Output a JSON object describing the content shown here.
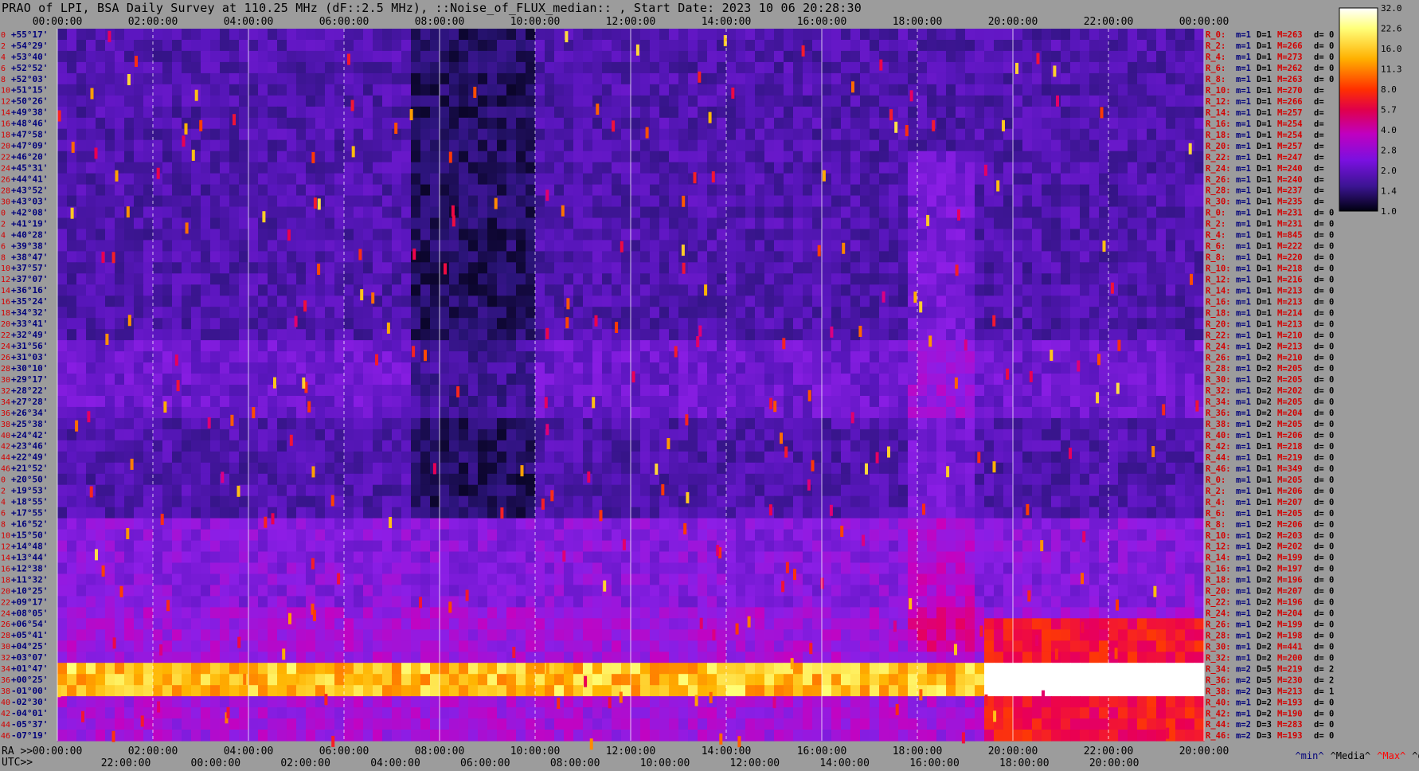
{
  "title": "PRAO of LPI, BSA Daily Survey at 110.25 MHz (dF::2.5 MHz), ::Noise_of_FLUX_median:: , Start Date: 2023 10 06 20:28:30",
  "footer": {
    "ra_label": "RA >>",
    "utc_label": "UTC>>"
  },
  "legend_bottom": {
    "min": "^min^",
    "media": "^Media^",
    "max": "^Max^",
    "devia": "^devia^"
  },
  "colors": {
    "background": "#9c9c9c",
    "label_red": "#d40000",
    "label_blue": "#00007a",
    "legend_max": "#ff0000"
  },
  "chart_data": {
    "type": "heatmap",
    "x_top_ticks": [
      "00:00:00",
      "02:00:00",
      "04:00:00",
      "06:00:00",
      "08:00:00",
      "10:00:00",
      "12:00:00",
      "14:00:00",
      "16:00:00",
      "18:00:00",
      "20:00:00",
      "22:00:00",
      "00:00:00"
    ],
    "x_bottom_ra_ticks": [
      "00:00:00",
      "02:00:00",
      "04:00:00",
      "06:00:00",
      "08:00:00",
      "10:00:00",
      "12:00:00",
      "14:00:00",
      "16:00:00",
      "18:00:00",
      "20:00:00",
      "22:00:00",
      "20:00:00"
    ],
    "x_bottom_utc_ticks": [
      "22:00:00",
      "00:00:00",
      "02:00:00",
      "04:00:00",
      "06:00:00",
      "08:00:00",
      "10:00:00",
      "12:00:00",
      "14:00:00",
      "16:00:00",
      "18:00:00",
      "20:00:00"
    ],
    "colorbar_ticks": [
      "32.0",
      "22.6",
      "16.0",
      "11.3",
      "8.0",
      "5.7",
      "4.0",
      "2.8",
      "2.0",
      "1.4",
      "1.0"
    ],
    "dec_labels": [
      "+55°17'",
      "+54°29'",
      "+53°40'",
      "+52°52'",
      "+52°03'",
      "+51°15'",
      "+50°26'",
      "+49°38'",
      "+48°46'",
      "+47°58'",
      "+47°09'",
      "+46°20'",
      "+45°31'",
      "+44°41'",
      "+43°52'",
      "+43°03'",
      "+42°08'",
      "+41°19'",
      "+40°28'",
      "+39°38'",
      "+38°47'",
      "+37°57'",
      "+37°07'",
      "+36°16'",
      "+35°24'",
      "+34°32'",
      "+33°41'",
      "+32°49'",
      "+31°56'",
      "+31°03'",
      "+30°10'",
      "+29°17'",
      "+28°22'",
      "+27°28'",
      "+26°34'",
      "+25°38'",
      "+24°42'",
      "+23°46'",
      "+22°49'",
      "+21°52'",
      "+20°50'",
      "+19°53'",
      "+18°55'",
      "+17°55'",
      "+16°52'",
      "+15°50'",
      "+14°48'",
      "+13°44'",
      "+12°38'",
      "+11°32'",
      "+10°25'",
      "+09°17'",
      "+08°05'",
      "+06°54'",
      "+05°41'",
      "+04°25'",
      "+03°07'",
      "+01°47'",
      "+00°25'",
      "-01°00'",
      "-02°30'",
      "-04°01'",
      "-05°37'",
      "-07°19'"
    ],
    "row_indices": [
      "0",
      "2",
      "4",
      "6",
      "8",
      "10",
      "12",
      "14",
      "16",
      "18",
      "20",
      "22",
      "24",
      "26",
      "28",
      "30",
      "0",
      "2",
      "4",
      "6",
      "8",
      "10",
      "12",
      "14",
      "16",
      "18",
      "20",
      "22",
      "24",
      "26",
      "28",
      "30",
      "32",
      "34",
      "36",
      "38",
      "40",
      "42",
      "44",
      "46",
      "0",
      "2",
      "4",
      "6",
      "8",
      "10",
      "12",
      "14",
      "16",
      "18",
      "20",
      "22",
      "24",
      "26",
      "28",
      "30",
      "32",
      "34",
      "36",
      "38",
      "40",
      "42",
      "44",
      "46"
    ],
    "right_labels": [
      {
        "r": "R_0:",
        "m": "m=1",
        "d": "D=1",
        "M": "M=263",
        "dev": "d= 0"
      },
      {
        "r": "R_2:",
        "m": "m=1",
        "d": "D=1",
        "M": "M=266",
        "dev": "d= 0"
      },
      {
        "r": "R_4:",
        "m": "m=1",
        "d": "D=1",
        "M": "M=273",
        "dev": "d= 0"
      },
      {
        "r": "R_6:",
        "m": "m=1",
        "d": "D=1",
        "M": "M=262",
        "dev": "d= 0"
      },
      {
        "r": "R_8:",
        "m": "m=1",
        "d": "D=1",
        "M": "M=263",
        "dev": "d= 0"
      },
      {
        "r": "R_10:",
        "m": "m=1",
        "d": "D=1",
        "M": "M=270",
        "dev": "d="
      },
      {
        "r": "R_12:",
        "m": "m=1",
        "d": "D=1",
        "M": "M=266",
        "dev": "d="
      },
      {
        "r": "R_14:",
        "m": "m=1",
        "d": "D=1",
        "M": "M=257",
        "dev": "d="
      },
      {
        "r": "R_16:",
        "m": "m=1",
        "d": "D=1",
        "M": "M=254",
        "dev": "d="
      },
      {
        "r": "R_18:",
        "m": "m=1",
        "d": "D=1",
        "M": "M=254",
        "dev": "d="
      },
      {
        "r": "R_20:",
        "m": "m=1",
        "d": "D=1",
        "M": "M=257",
        "dev": "d="
      },
      {
        "r": "R_22:",
        "m": "m=1",
        "d": "D=1",
        "M": "M=247",
        "dev": "d="
      },
      {
        "r": "R_24:",
        "m": "m=1",
        "d": "D=1",
        "M": "M=240",
        "dev": "d="
      },
      {
        "r": "R_26:",
        "m": "m=1",
        "d": "D=1",
        "M": "M=240",
        "dev": "d="
      },
      {
        "r": "R_28:",
        "m": "m=1",
        "d": "D=1",
        "M": "M=237",
        "dev": "d="
      },
      {
        "r": "R_30:",
        "m": "m=1",
        "d": "D=1",
        "M": "M=235",
        "dev": "d="
      },
      {
        "r": "R_0:",
        "m": "m=1",
        "d": "D=1",
        "M": "M=231",
        "dev": "d= 0"
      },
      {
        "r": "R_2:",
        "m": "m=1",
        "d": "D=1",
        "M": "M=231",
        "dev": "d= 0"
      },
      {
        "r": "R_4:",
        "m": "m=1",
        "d": "D=1",
        "M": "M=845",
        "dev": "d= 0"
      },
      {
        "r": "R_6:",
        "m": "m=1",
        "d": "D=1",
        "M": "M=222",
        "dev": "d= 0"
      },
      {
        "r": "R_8:",
        "m": "m=1",
        "d": "D=1",
        "M": "M=220",
        "dev": "d= 0"
      },
      {
        "r": "R_10:",
        "m": "m=1",
        "d": "D=1",
        "M": "M=218",
        "dev": "d= 0"
      },
      {
        "r": "R_12:",
        "m": "m=1",
        "d": "D=1",
        "M": "M=216",
        "dev": "d= 0"
      },
      {
        "r": "R_14:",
        "m": "m=1",
        "d": "D=1",
        "M": "M=213",
        "dev": "d= 0"
      },
      {
        "r": "R_16:",
        "m": "m=1",
        "d": "D=1",
        "M": "M=213",
        "dev": "d= 0"
      },
      {
        "r": "R_18:",
        "m": "m=1",
        "d": "D=1",
        "M": "M=214",
        "dev": "d= 0"
      },
      {
        "r": "R_20:",
        "m": "m=1",
        "d": "D=1",
        "M": "M=213",
        "dev": "d= 0"
      },
      {
        "r": "R_22:",
        "m": "m=1",
        "d": "D=1",
        "M": "M=210",
        "dev": "d= 0"
      },
      {
        "r": "R_24:",
        "m": "m=1",
        "d": "D=2",
        "M": "M=213",
        "dev": "d= 0"
      },
      {
        "r": "R_26:",
        "m": "m=1",
        "d": "D=2",
        "M": "M=210",
        "dev": "d= 0"
      },
      {
        "r": "R_28:",
        "m": "m=1",
        "d": "D=2",
        "M": "M=205",
        "dev": "d= 0"
      },
      {
        "r": "R_30:",
        "m": "m=1",
        "d": "D=2",
        "M": "M=205",
        "dev": "d= 0"
      },
      {
        "r": "R_32:",
        "m": "m=1",
        "d": "D=2",
        "M": "M=202",
        "dev": "d= 0"
      },
      {
        "r": "R_34:",
        "m": "m=1",
        "d": "D=2",
        "M": "M=205",
        "dev": "d= 0"
      },
      {
        "r": "R_36:",
        "m": "m=1",
        "d": "D=2",
        "M": "M=204",
        "dev": "d= 0"
      },
      {
        "r": "R_38:",
        "m": "m=1",
        "d": "D=2",
        "M": "M=205",
        "dev": "d= 0"
      },
      {
        "r": "R_40:",
        "m": "m=1",
        "d": "D=1",
        "M": "M=206",
        "dev": "d= 0"
      },
      {
        "r": "R_42:",
        "m": "m=1",
        "d": "D=1",
        "M": "M=218",
        "dev": "d= 0"
      },
      {
        "r": "R_44:",
        "m": "m=1",
        "d": "D=1",
        "M": "M=219",
        "dev": "d= 0"
      },
      {
        "r": "R_46:",
        "m": "m=1",
        "d": "D=1",
        "M": "M=349",
        "dev": "d= 0"
      },
      {
        "r": "R_0:",
        "m": "m=1",
        "d": "D=1",
        "M": "M=205",
        "dev": "d= 0"
      },
      {
        "r": "R_2:",
        "m": "m=1",
        "d": "D=1",
        "M": "M=206",
        "dev": "d= 0"
      },
      {
        "r": "R_4:",
        "m": "m=1",
        "d": "D=1",
        "M": "M=207",
        "dev": "d= 0"
      },
      {
        "r": "R_6:",
        "m": "m=1",
        "d": "D=1",
        "M": "M=205",
        "dev": "d= 0"
      },
      {
        "r": "R_8:",
        "m": "m=1",
        "d": "D=2",
        "M": "M=206",
        "dev": "d= 0"
      },
      {
        "r": "R_10:",
        "m": "m=1",
        "d": "D=2",
        "M": "M=203",
        "dev": "d= 0"
      },
      {
        "r": "R_12:",
        "m": "m=1",
        "d": "D=2",
        "M": "M=202",
        "dev": "d= 0"
      },
      {
        "r": "R_14:",
        "m": "m=1",
        "d": "D=2",
        "M": "M=199",
        "dev": "d= 0"
      },
      {
        "r": "R_16:",
        "m": "m=1",
        "d": "D=2",
        "M": "M=197",
        "dev": "d= 0"
      },
      {
        "r": "R_18:",
        "m": "m=1",
        "d": "D=2",
        "M": "M=196",
        "dev": "d= 0"
      },
      {
        "r": "R_20:",
        "m": "m=1",
        "d": "D=2",
        "M": "M=207",
        "dev": "d= 0"
      },
      {
        "r": "R_22:",
        "m": "m=1",
        "d": "D=2",
        "M": "M=196",
        "dev": "d= 0"
      },
      {
        "r": "R_24:",
        "m": "m=1",
        "d": "D=2",
        "M": "M=204",
        "dev": "d= 0"
      },
      {
        "r": "R_26:",
        "m": "m=1",
        "d": "D=2",
        "M": "M=199",
        "dev": "d= 0"
      },
      {
        "r": "R_28:",
        "m": "m=1",
        "d": "D=2",
        "M": "M=198",
        "dev": "d= 0"
      },
      {
        "r": "R_30:",
        "m": "m=1",
        "d": "D=2",
        "M": "M=441",
        "dev": "d= 0"
      },
      {
        "r": "R_32:",
        "m": "m=1",
        "d": "D=2",
        "M": "M=200",
        "dev": "d= 0"
      },
      {
        "r": "R_34:",
        "m": "m=2",
        "d": "D=5",
        "M": "M=219",
        "dev": "d= 2"
      },
      {
        "r": "R_36:",
        "m": "m=2",
        "d": "D=5",
        "M": "M=230",
        "dev": "d= 2"
      },
      {
        "r": "R_38:",
        "m": "m=2",
        "d": "D=3",
        "M": "M=213",
        "dev": "d= 1"
      },
      {
        "r": "R_40:",
        "m": "m=1",
        "d": "D=2",
        "M": "M=193",
        "dev": "d= 0"
      },
      {
        "r": "R_42:",
        "m": "m=1",
        "d": "D=2",
        "M": "M=190",
        "dev": "d= 0"
      },
      {
        "r": "R_44:",
        "m": "m=2",
        "d": "D=3",
        "M": "M=283",
        "dev": "d= 0"
      },
      {
        "r": "R_46:",
        "m": "m=2",
        "d": "D=3",
        "M": "M=193",
        "dev": "d= 0"
      }
    ]
  }
}
